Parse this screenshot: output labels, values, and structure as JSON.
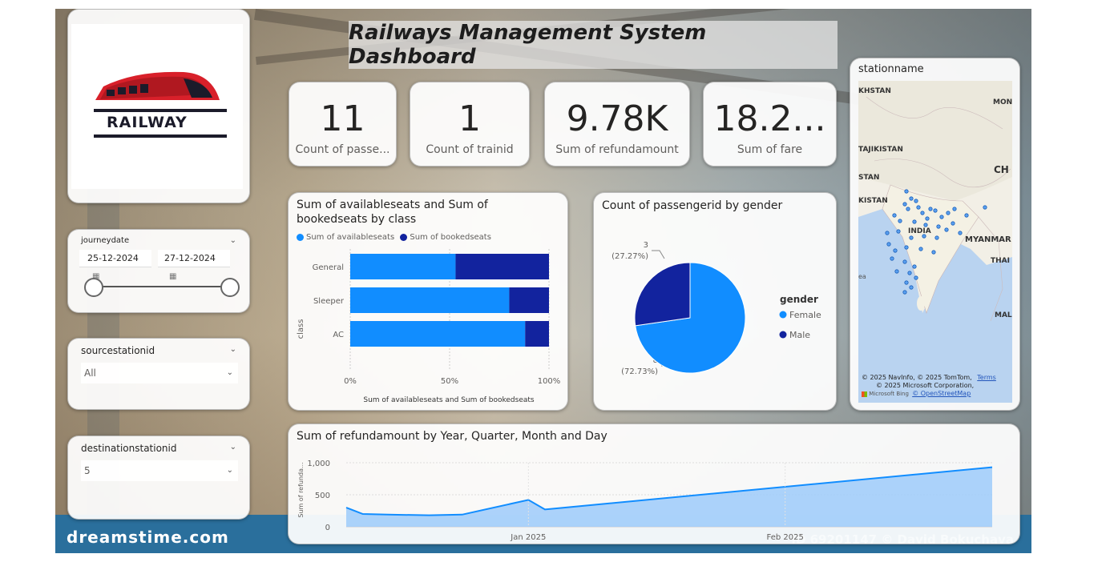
{
  "colors": {
    "light_blue": "#118DFF",
    "dark_blue": "#12239E",
    "area": "#9DCBFA"
  },
  "title": "Railways Management System Dashboard",
  "logo": {
    "text": "RAILWAY"
  },
  "kpis": [
    {
      "value": "11",
      "label": "Count of passe..."
    },
    {
      "value": "1",
      "label": "Count of trainid"
    },
    {
      "value": "9.78K",
      "label": "Sum of refundamount"
    },
    {
      "value": "18.2...",
      "label": "Sum of fare"
    }
  ],
  "journeydate": {
    "label": "journeydate",
    "start": "25-12-2024",
    "end": "27-12-2024"
  },
  "sourcestation": {
    "label": "sourcestationid",
    "value": "All"
  },
  "destinationstation": {
    "label": "destinationstationid",
    "value": "5"
  },
  "bar_chart": {
    "title": "Sum of availableseats and Sum of bookedseats by class",
    "legend": [
      "Sum of availableseats",
      "Sum of bookedseats"
    ],
    "ylabel": "class",
    "xlabel": "Sum of availableseats and Sum of bookedseats",
    "ticks": [
      "0%",
      "50%",
      "100%"
    ]
  },
  "pie_chart": {
    "title": "Count of passengerid by gender",
    "legend_title": "gender",
    "legend": [
      "Female",
      "Male"
    ],
    "label_male_count": "3",
    "label_male_pct": "(27.27%)",
    "label_female_count": "8",
    "label_female_pct": "(72.73%)"
  },
  "map": {
    "title": "stationname",
    "labels": [
      "KHSTAN",
      "MON",
      "TAJIKISTAN",
      "CH",
      "STAN",
      "KISTAN",
      "INDIA",
      "MYANMAR",
      "THAI",
      "MAL",
      "ea"
    ],
    "attribution1": "© 2025 NavInfo, © 2025 TomTom,",
    "terms": "Terms",
    "attribution2": "© 2025 Microsoft Corporation,",
    "bing": "Microsoft Bing",
    "osm": "© OpenStreetMap"
  },
  "area_chart": {
    "title": "Sum of refundamount by Year, Quarter, Month and Day",
    "ylabel": "Sum of refunda...",
    "yticks": [
      "1,000",
      "500",
      "0"
    ],
    "xticks": [
      "Jan 2025",
      "Feb 2025"
    ]
  },
  "watermark": {
    "site": "dreamstime.com",
    "id": "ID 69201147 © David Bokuchava"
  },
  "chart_data": [
    {
      "type": "bar",
      "title": "Sum of availableseats and Sum of bookedseats by class",
      "categories": [
        "General",
        "Sleeper",
        "AC"
      ],
      "series": [
        {
          "name": "Sum of availableseats",
          "values": [
            53,
            80,
            88
          ]
        },
        {
          "name": "Sum of bookedseats",
          "values": [
            47,
            20,
            12
          ]
        }
      ],
      "xlabel": "Sum of availableseats and Sum of bookedseats",
      "ylabel": "class",
      "xlim": [
        0,
        100
      ]
    },
    {
      "type": "pie",
      "title": "Count of passengerid by gender",
      "categories": [
        "Female",
        "Male"
      ],
      "values": [
        8,
        3
      ]
    },
    {
      "type": "area",
      "title": "Sum of refundamount by Year, Quarter, Month and Day",
      "x": [
        "2024-12-10",
        "2024-12-12",
        "2024-12-15",
        "2024-12-20",
        "2024-12-24",
        "2025-01-01",
        "2025-01-03",
        "2025-02-26"
      ],
      "values": [
        300,
        200,
        190,
        180,
        190,
        420,
        270,
        930
      ],
      "ylabel": "Sum of refunda...",
      "ylim": [
        0,
        1000
      ]
    }
  ]
}
